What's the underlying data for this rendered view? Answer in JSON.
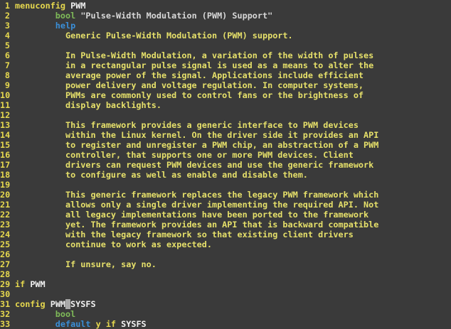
{
  "editor": {
    "lines": [
      {
        "n": "1",
        "indent": 0,
        "parts": [
          [
            "kw",
            "menuconfig "
          ],
          [
            "id",
            "PWM"
          ]
        ]
      },
      {
        "n": "2",
        "indent": 8,
        "parts": [
          [
            "type",
            "bool "
          ],
          [
            "str",
            "\"Pulse-Width Modulation (PWM) Support\""
          ]
        ]
      },
      {
        "n": "3",
        "indent": 8,
        "parts": [
          [
            "help",
            "help"
          ]
        ]
      },
      {
        "n": "4",
        "indent": 10,
        "parts": [
          [
            "txt",
            "Generic Pulse-Width Modulation (PWM) support."
          ]
        ]
      },
      {
        "n": "5",
        "indent": 0,
        "parts": []
      },
      {
        "n": "6",
        "indent": 10,
        "parts": [
          [
            "txt",
            "In Pulse-Width Modulation, a variation of the width of pulses"
          ]
        ]
      },
      {
        "n": "7",
        "indent": 10,
        "parts": [
          [
            "txt",
            "in a rectangular pulse signal is used as a means to alter the"
          ]
        ]
      },
      {
        "n": "8",
        "indent": 10,
        "parts": [
          [
            "txt",
            "average power of the signal. Applications include efficient"
          ]
        ]
      },
      {
        "n": "9",
        "indent": 10,
        "parts": [
          [
            "txt",
            "power delivery and voltage regulation. In computer systems,"
          ]
        ]
      },
      {
        "n": "10",
        "indent": 10,
        "parts": [
          [
            "txt",
            "PWMs are commonly used to control fans or the brightness of"
          ]
        ]
      },
      {
        "n": "11",
        "indent": 10,
        "parts": [
          [
            "txt",
            "display backlights."
          ]
        ]
      },
      {
        "n": "12",
        "indent": 0,
        "parts": []
      },
      {
        "n": "13",
        "indent": 10,
        "parts": [
          [
            "txt",
            "This framework provides a generic interface to PWM devices"
          ]
        ]
      },
      {
        "n": "14",
        "indent": 10,
        "parts": [
          [
            "txt",
            "within the Linux kernel. On the driver side it provides an API"
          ]
        ]
      },
      {
        "n": "15",
        "indent": 10,
        "parts": [
          [
            "txt",
            "to register and unregister a PWM chip, an abstraction of a PWM"
          ]
        ]
      },
      {
        "n": "16",
        "indent": 10,
        "parts": [
          [
            "txt",
            "controller, that supports one or more PWM devices. Client"
          ]
        ]
      },
      {
        "n": "17",
        "indent": 10,
        "parts": [
          [
            "txt",
            "drivers can request PWM devices and use the generic framework"
          ]
        ]
      },
      {
        "n": "18",
        "indent": 10,
        "parts": [
          [
            "txt",
            "to configure as well as enable and disable them."
          ]
        ]
      },
      {
        "n": "19",
        "indent": 0,
        "parts": []
      },
      {
        "n": "20",
        "indent": 10,
        "parts": [
          [
            "txt",
            "This generic framework replaces the legacy PWM framework which"
          ]
        ]
      },
      {
        "n": "21",
        "indent": 10,
        "parts": [
          [
            "txt",
            "allows only a single driver implementing the required API. Not"
          ]
        ]
      },
      {
        "n": "22",
        "indent": 10,
        "parts": [
          [
            "txt",
            "all legacy implementations have been ported to the framework"
          ]
        ]
      },
      {
        "n": "23",
        "indent": 10,
        "parts": [
          [
            "txt",
            "yet. The framework provides an API that is backward compatible"
          ]
        ]
      },
      {
        "n": "24",
        "indent": 10,
        "parts": [
          [
            "txt",
            "with the legacy framework so that existing client drivers"
          ]
        ]
      },
      {
        "n": "25",
        "indent": 10,
        "parts": [
          [
            "txt",
            "continue to work as expected."
          ]
        ]
      },
      {
        "n": "26",
        "indent": 0,
        "parts": []
      },
      {
        "n": "27",
        "indent": 10,
        "parts": [
          [
            "txt",
            "If unsure, say no."
          ]
        ]
      },
      {
        "n": "28",
        "indent": 0,
        "parts": []
      },
      {
        "n": "29",
        "indent": 0,
        "parts": [
          [
            "kw",
            "if "
          ],
          [
            "id",
            "PWM"
          ]
        ]
      },
      {
        "n": "30",
        "indent": 0,
        "parts": []
      },
      {
        "n": "31",
        "indent": 0,
        "parts": [
          [
            "kw",
            "config "
          ],
          [
            "id",
            "PWM"
          ],
          [
            "cur",
            " "
          ],
          [
            "id",
            "SYSFS"
          ]
        ]
      },
      {
        "n": "32",
        "indent": 8,
        "parts": [
          [
            "type",
            "bool"
          ]
        ]
      },
      {
        "n": "33",
        "indent": 8,
        "parts": [
          [
            "def",
            "default "
          ],
          [
            "kw",
            "y if "
          ],
          [
            "id",
            "SYSFS"
          ]
        ]
      }
    ]
  }
}
